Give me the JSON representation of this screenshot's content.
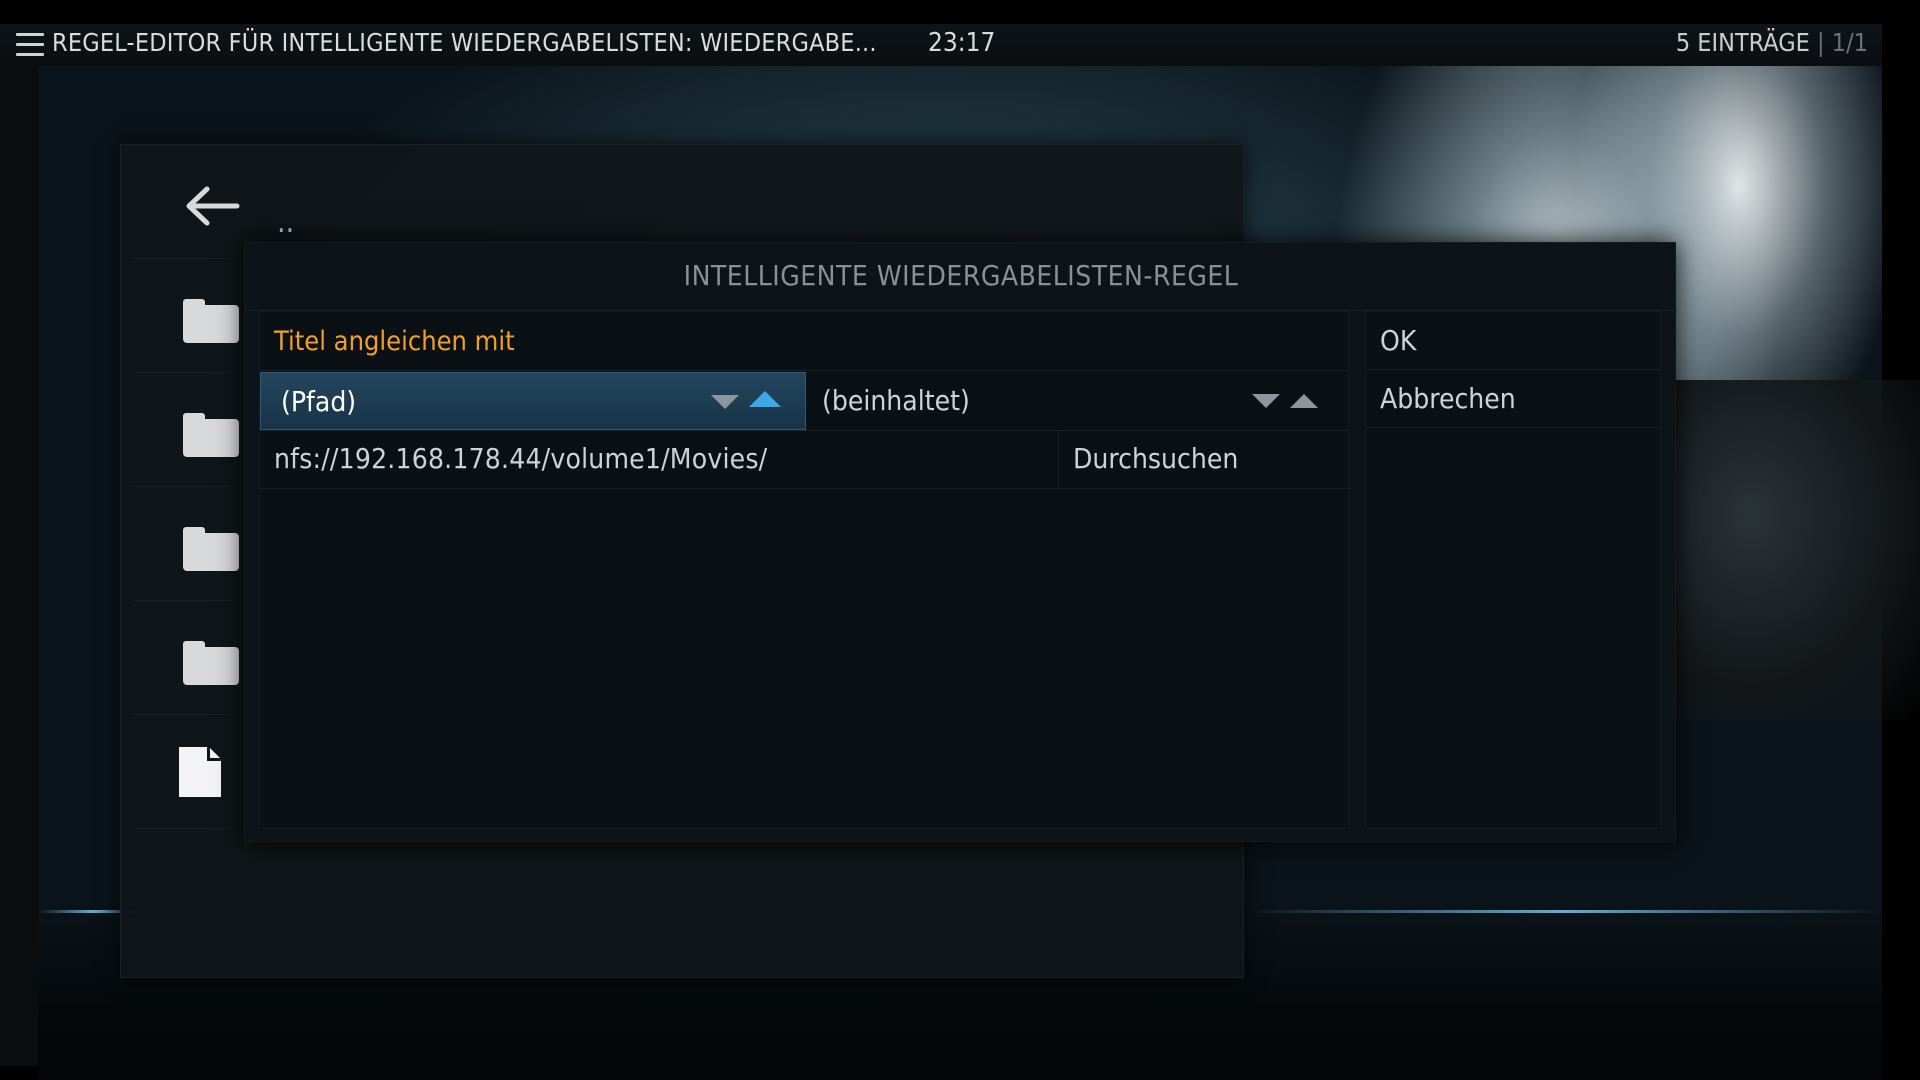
{
  "header": {
    "title": "REGEL-EDITOR FÜR INTELLIGENTE WIEDERGABELISTEN: WIEDERGABE...",
    "clock": "23:17",
    "count": "5 EINTRÄGE",
    "separator": "|",
    "page": "1/1"
  },
  "browser": {
    "parent_label": "..",
    "items": [
      {
        "icon": "folder-icon"
      },
      {
        "icon": "folder-icon"
      },
      {
        "icon": "folder-icon"
      },
      {
        "icon": "folder-icon"
      },
      {
        "icon": "file-icon"
      }
    ]
  },
  "dialog": {
    "title": "INTELLIGENTE WIEDERGABELISTEN-REGEL",
    "rule_label": "Titel angleichen mit",
    "field_value": "(Pfad)",
    "operator_value": "(beinhaltet)",
    "path_value": "nfs://192.168.178.44/volume1/Movies/",
    "browse_label": "Durchsuchen",
    "ok_label": "OK",
    "cancel_label": "Abbrechen"
  },
  "colors": {
    "accent": "#3da8e6",
    "label_orange": "#f0a02a",
    "focus_bg": "#1e3f55"
  }
}
